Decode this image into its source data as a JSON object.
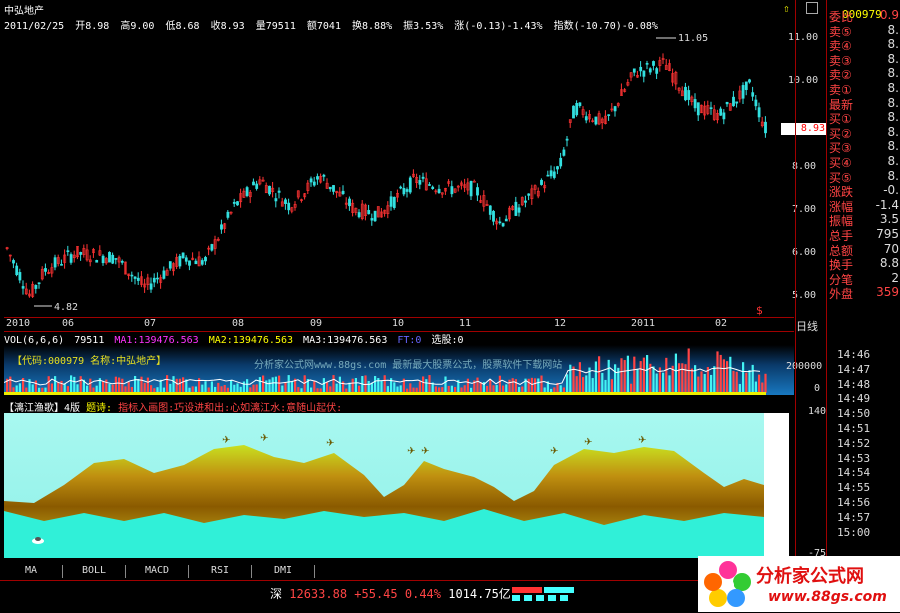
{
  "header": {
    "stock_name": "中弘地产",
    "quote": {
      "date": "2011/02/25",
      "open": "开8.98",
      "high": "高9.00",
      "low": "低8.68",
      "close": "收8.93",
      "volume": "量79511",
      "amount": "额7041",
      "turnover": "换8.88%",
      "amplitude": "振3.53%",
      "change": "涨(-0.13)-1.43%",
      "index": "指数(-10.70)-0.08%"
    },
    "stock_code": "000979"
  },
  "price_axis": {
    "ticks": [
      "11.00",
      "10.00",
      "9.00",
      "8.00",
      "7.00",
      "6.00",
      "5.00"
    ],
    "current_price": "8.93",
    "max_label": "11.05",
    "min_label": "4.82"
  },
  "date_axis": {
    "labels": [
      "2010",
      "06",
      "07",
      "08",
      "09",
      "10",
      "11",
      "12",
      "2011",
      "02"
    ],
    "period": "日线"
  },
  "volume": {
    "legend": {
      "vol": "VOL(6,6,6)",
      "vol_value": "79511",
      "ma1": "MA1:139476.563",
      "ma2": "MA2:139476.563",
      "ma3": "MA3:139476.563",
      "ft": "FT:0",
      "xuangu": "选股:0"
    },
    "overlay_code": "【代码:000979 名称:中弘地产】",
    "overlay_site": "分析家公式网www.88gs.com 最新最大股票公式，股票软件下载网站",
    "axis_ticks": [
      "200000",
      "0"
    ]
  },
  "indicator": {
    "name": "【漓江渔歌】4版",
    "poem_label": "题诗:",
    "poem": "指标入画图:巧设进和出:心如漓江水:意随山起伏:",
    "axis_top": "140",
    "axis_bottom": "-75"
  },
  "side_panel": {
    "code": "000979",
    "rows": [
      {
        "label": "委比",
        "value": "0.9"
      },
      {
        "label": "卖⑤",
        "value": "8."
      },
      {
        "label": "卖④",
        "value": "8."
      },
      {
        "label": "卖③",
        "value": "8."
      },
      {
        "label": "卖②",
        "value": "8."
      },
      {
        "label": "卖①",
        "value": "8."
      },
      {
        "label": "最新",
        "value": "8."
      },
      {
        "label": "买①",
        "value": "8."
      },
      {
        "label": "买②",
        "value": "8."
      },
      {
        "label": "买③",
        "value": "8."
      },
      {
        "label": "买④",
        "value": "8."
      },
      {
        "label": "买⑤",
        "value": "8."
      },
      {
        "label": "涨跌",
        "value": "-0."
      },
      {
        "label": "涨幅",
        "value": "-1.4"
      },
      {
        "label": "振幅",
        "value": "3.5"
      },
      {
        "label": "总手",
        "value": "795"
      },
      {
        "label": "总额",
        "value": "70"
      },
      {
        "label": "换手",
        "value": "8.8"
      },
      {
        "label": "分笔",
        "value": "2"
      },
      {
        "label": "外盘",
        "value": "359"
      }
    ],
    "times": [
      "14:46",
      "14:47",
      "14:48",
      "14:49",
      "14:50",
      "14:51",
      "14:52",
      "14:53",
      "14:54",
      "14:55",
      "14:56",
      "14:57",
      "15:00"
    ]
  },
  "tabs": [
    "MA",
    "BOLL",
    "MACD",
    "RSI",
    "DMI"
  ],
  "status": {
    "market": "深",
    "index_value": "12633.88",
    "index_change": "+55.45",
    "index_pct": "0.44%",
    "turnover": "1014.75亿"
  },
  "logo": {
    "text": "分析家公式网",
    "url": "www.88gs.com"
  },
  "colors": {
    "up": "#ff3333",
    "down": "#33e0e0",
    "border": "#a00000",
    "sky": "#9ff4ec"
  }
}
